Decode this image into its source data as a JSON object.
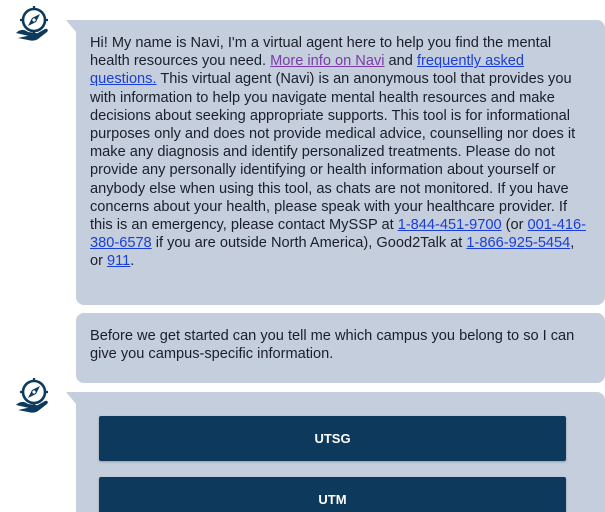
{
  "bot": {
    "avatar_icon": "navi-compass-hand-icon",
    "colors": {
      "bubble_bg": "#c5cedc",
      "button_bg": "#0d3a5c",
      "link": "#1a3fd6",
      "link_visited": "#7b3ba8"
    }
  },
  "messages": {
    "intro": {
      "p1": "Hi! My name is Navi, I'm a virtual agent here to help you find the mental health resources you need. ",
      "link_more_info": "More info on Navi",
      "p2": " and ",
      "link_faq": "frequently asked questions.",
      "p3": " This virtual agent (Navi) is an anonymous tool that provides you with information to help you navigate mental health resources and make decisions about seeking appropriate supports. This tool is for informational purposes only and does not provide medical advice, counselling nor does it make any diagnosis and identify personalized treatments. Please do not provide any personally identifying or health information about yourself or anybody else when using this tool, as chats are not monitored. If you have concerns about your health, please speak with your healthcare provider. If this is an emergency, please contact MySSP at ",
      "phone_myssp": "1-844-451-9700",
      "p4": " (or ",
      "phone_myssp_intl": "001-416-380-6578",
      "p5": " if you are outside North America), Good2Talk at ",
      "phone_good2talk": "1-866-925-5454",
      "p6": ", or ",
      "phone_emergency": "911",
      "p7": "."
    },
    "campus_question": "Before we get started can you tell me which campus you belong to so I can give you campus-specific information."
  },
  "choices": [
    {
      "label": "UTSG"
    },
    {
      "label": "UTM"
    }
  ]
}
